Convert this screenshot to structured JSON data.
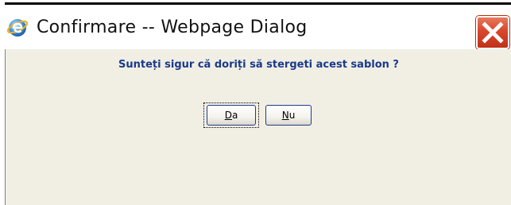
{
  "window": {
    "title": "Confirmare -- Webpage Dialog",
    "icon": "internet-explorer-icon",
    "close_icon": "close-x-icon"
  },
  "dialog": {
    "message": "Sunteți sigur că doriți să stergeti acest sablon ?"
  },
  "buttons": {
    "yes": {
      "accesskey": "D",
      "rest": "a"
    },
    "no": {
      "accesskey": "N",
      "rest": "u"
    }
  },
  "colors": {
    "message_text": "#1a3a8a",
    "close_button": "#d9462b",
    "client_background": "#f1efe4"
  }
}
